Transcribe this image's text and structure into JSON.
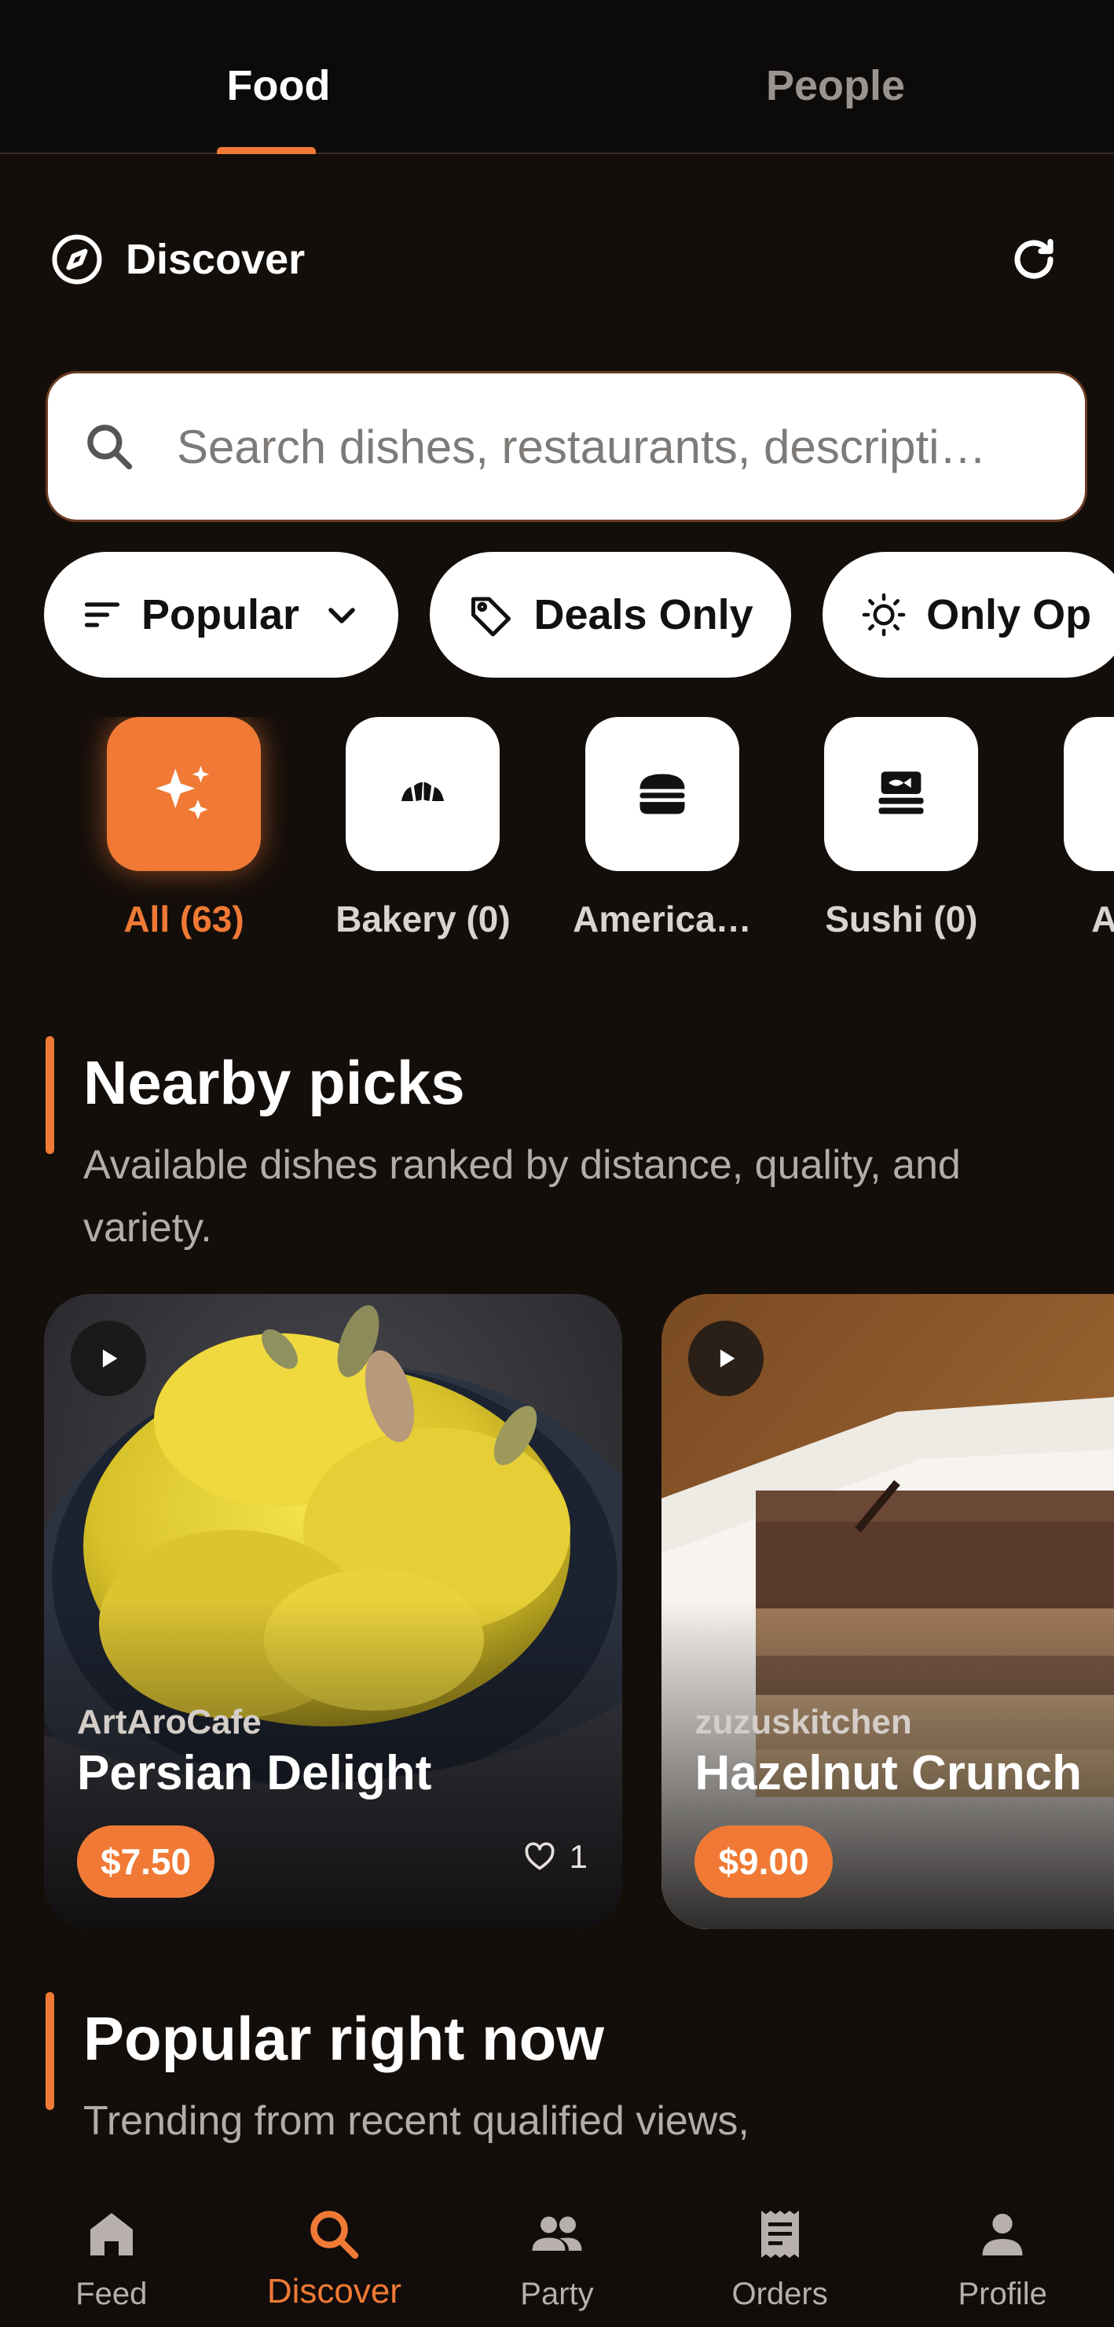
{
  "top_tabs": [
    {
      "label": "Food",
      "active": true
    },
    {
      "label": "People",
      "active": false
    }
  ],
  "discover": {
    "title": "Discover",
    "icon": "compass-icon",
    "refresh_icon": "refresh-icon"
  },
  "search": {
    "placeholder": "Search dishes, restaurants, descripti…"
  },
  "filter_chips": [
    {
      "label": "Popular",
      "icon": "sort-icon",
      "has_dropdown": true
    },
    {
      "label": "Deals Only",
      "icon": "tag-icon"
    },
    {
      "label": "Only Op",
      "icon": "sun-icon"
    }
  ],
  "categories": [
    {
      "label": "All (63)",
      "icon": "sparkles-icon",
      "active": true
    },
    {
      "label": "Bakery (0)",
      "icon": "croissant-icon"
    },
    {
      "label": "America…",
      "icon": "burger-icon"
    },
    {
      "label": "Sushi (0)",
      "icon": "sushi-icon"
    },
    {
      "label": "Asian",
      "icon": "noodle-bowl-icon"
    }
  ],
  "nearby": {
    "title": "Nearby picks",
    "subtitle": "Available dishes ranked by distance, quality, and variety."
  },
  "cards": [
    {
      "vendor": "ArtAroCafe",
      "dish": "Persian Delight",
      "price": "$7.50",
      "likes": "1"
    },
    {
      "vendor": "zuzuskitchen",
      "dish": "Hazelnut Crunch",
      "price": "$9.00"
    }
  ],
  "popular": {
    "title": "Popular right now",
    "subtitle": "Trending from recent qualified views,"
  },
  "bottom_nav": [
    {
      "label": "Feed",
      "icon": "home-icon"
    },
    {
      "label": "Discover",
      "icon": "search-icon",
      "active": true
    },
    {
      "label": "Party",
      "icon": "people-icon"
    },
    {
      "label": "Orders",
      "icon": "receipt-icon"
    },
    {
      "label": "Profile",
      "icon": "person-icon"
    }
  ],
  "colors": {
    "accent": "#f07a35",
    "background": "#140e0b",
    "tab_bar": "#0d0b0a"
  }
}
